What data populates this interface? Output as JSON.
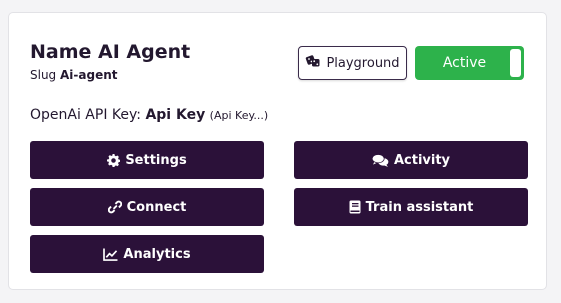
{
  "agent": {
    "name": "Name AI Agent",
    "slug_label": "Slug",
    "slug_value": "Ai-agent"
  },
  "header_actions": {
    "playground_label": "Playground",
    "playground_icon": "dice-icon",
    "status_label": "Active",
    "status_on": true,
    "status_color": "#2db24b"
  },
  "api_key": {
    "label": "OpenAi API Key:",
    "value": "Api Key",
    "note": "(Api Key...)"
  },
  "actions": {
    "settings": {
      "label": "Settings",
      "icon": "gear-icon"
    },
    "activity": {
      "label": "Activity",
      "icon": "comments-icon"
    },
    "connect": {
      "label": "Connect",
      "icon": "link-icon"
    },
    "train": {
      "label": "Train assistant",
      "icon": "book-icon"
    },
    "analytics": {
      "label": "Analytics",
      "icon": "chart-line-icon"
    }
  },
  "colors": {
    "button_bg": "#2b1139",
    "text": "#23182f",
    "card_bg": "#ffffff",
    "page_bg": "#f4f4f6"
  }
}
